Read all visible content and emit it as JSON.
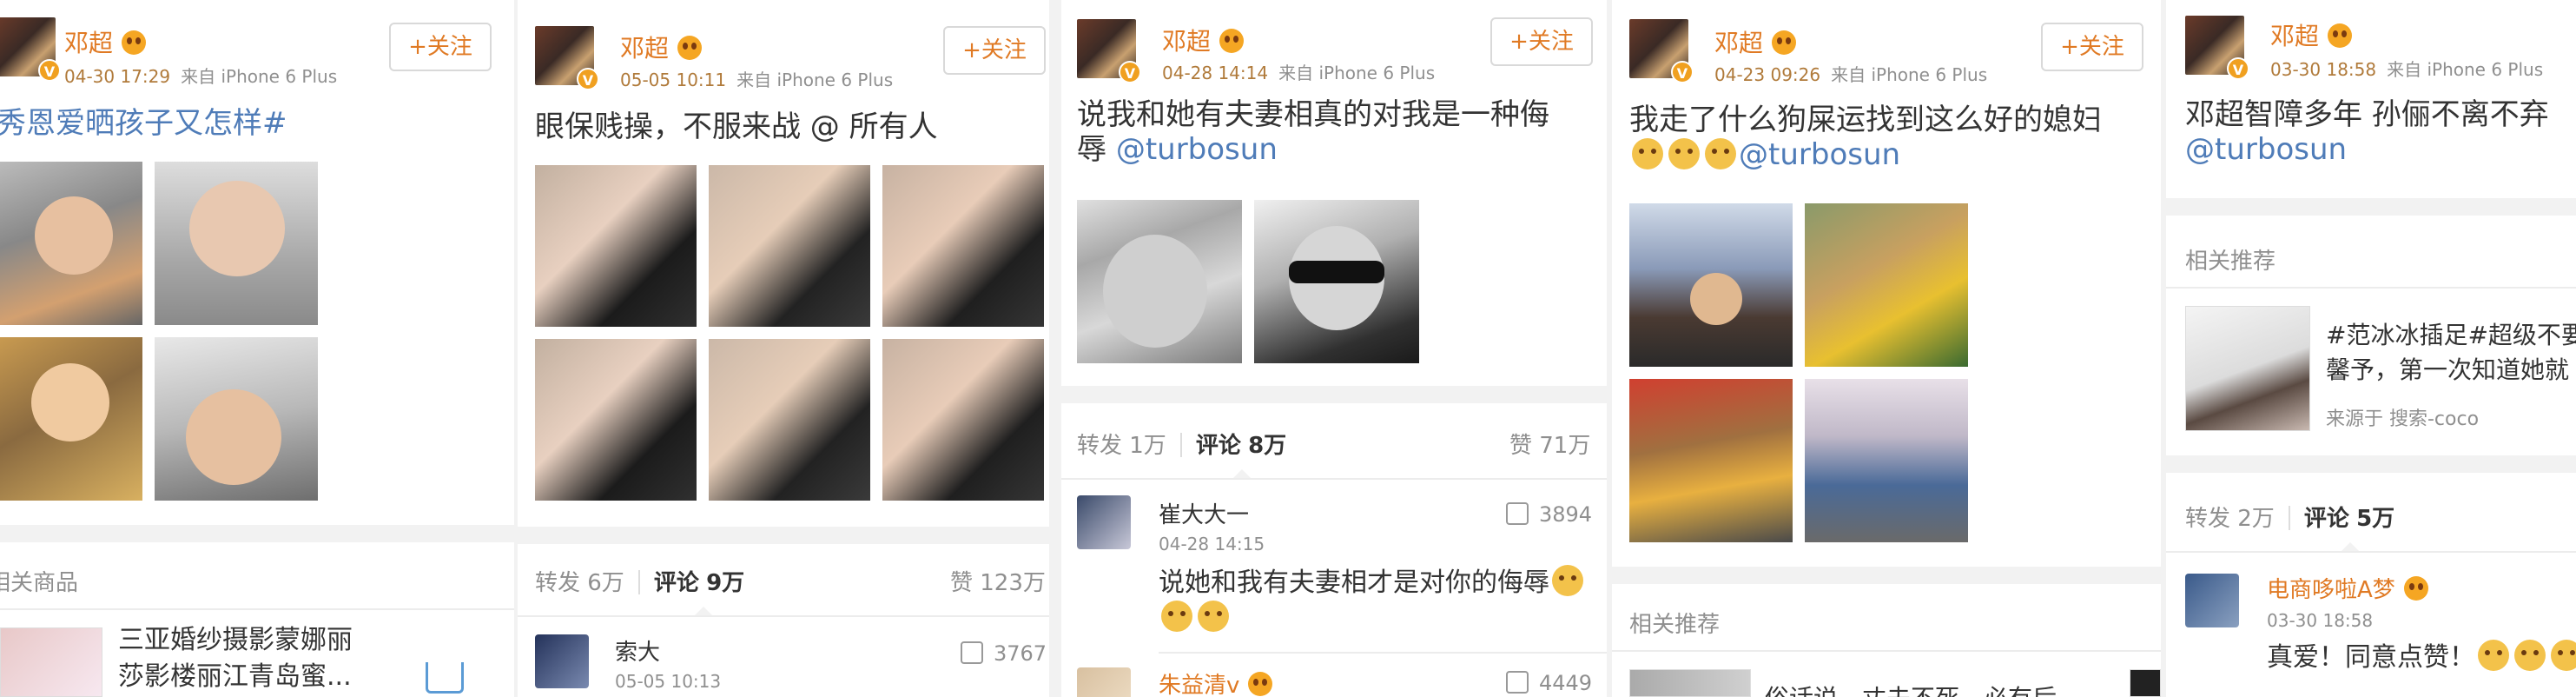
{
  "user": {
    "name": "邓超",
    "verified": "V"
  },
  "follow_label": "+关注",
  "panels": [
    {
      "time": "04-30 17:29",
      "source": "来自 iPhone 6 Plus",
      "text_hashtag": "秀恩爱晒孩子又怎样#",
      "section": "相关商品",
      "product": {
        "line1": "三亚婚纱摄影蒙娜丽",
        "line2": "莎影楼丽江青岛蜜..."
      }
    },
    {
      "time": "05-05 10:11",
      "source": "来自 iPhone 6 Plus",
      "text": "眼保贱操，不服来战 @ 所有人",
      "stats": {
        "repost": "转发 6万",
        "comment_label": "评论",
        "comment_count": "9万",
        "like": "赞 123万"
      },
      "comment": {
        "name": "索大",
        "time": "05-05 10:13",
        "likes": "3767"
      }
    },
    {
      "time": "04-28 14:14",
      "source": "来自 iPhone 6 Plus",
      "text_line1": "说我和她有夫妻相真的对我是一种侮",
      "text_line2_prefix": "辱 ",
      "mention": "@turbosun",
      "stats": {
        "repost": "转发 1万",
        "comment_label": "评论",
        "comment_count": "8万",
        "like": "赞 71万"
      },
      "comment1": {
        "name": "崔大大一",
        "time": "04-28 14:15",
        "likes": "3894",
        "text": "说她和我有夫妻相才是对你的侮辱"
      },
      "comment2": {
        "name": "朱益清v",
        "likes": "4449"
      }
    },
    {
      "time": "04-23 09:26",
      "source": "来自 iPhone 6 Plus",
      "text_line1": "我走了什么狗屎运找到这么好的媳妇",
      "mention": "@turbosun",
      "section": "相关推荐",
      "reco_snippet": "俗话说，丈夫不死，必有后"
    },
    {
      "time": "03-30 18:58",
      "source": "来自 iPhone 6 Plus",
      "text_line1": "邓超智障多年 孙俪不离不弃",
      "mention": "@turbosun",
      "section": "相关推荐",
      "reco": {
        "line1": "#范冰冰插足#超级不要",
        "line2": "馨予，第一次知道她就",
        "source": "来源于 搜索-coco"
      },
      "stats": {
        "repost": "转发 2万",
        "comment_label": "评论",
        "comment_count": "5万"
      },
      "comment": {
        "name": "电商哆啦A梦",
        "time": "03-30 18:58",
        "text": "真爱！同意点赞！"
      }
    }
  ]
}
